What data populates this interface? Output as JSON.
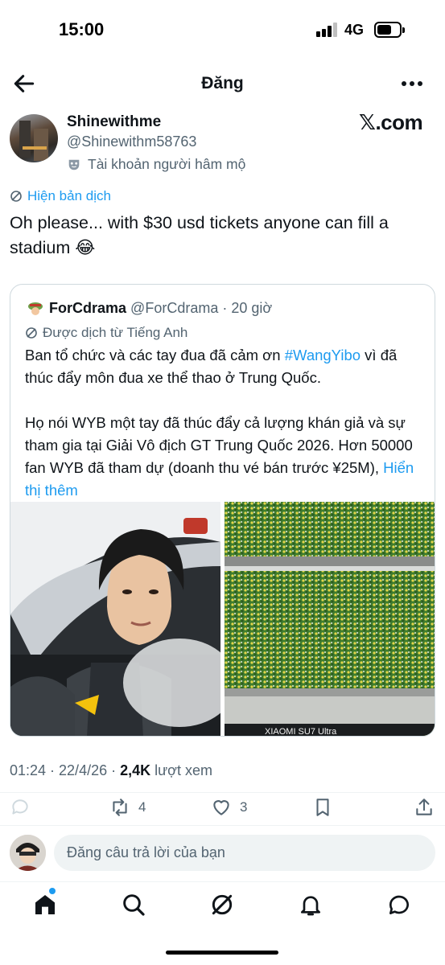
{
  "status_bar": {
    "time": "15:00",
    "network": "4G"
  },
  "header": {
    "title": "Đăng",
    "back_icon": "arrow-left-icon",
    "more_icon": "more-horizontal-icon"
  },
  "author": {
    "display_name": "Shinewithme",
    "handle": "@Shinewithm58763",
    "badge_text": "Tài khoản người hâm mộ",
    "badge_icon": "mask-icon",
    "watermark": "𝕏.com"
  },
  "post": {
    "translate_link": "Hiện bản dịch",
    "text_line1": "Oh please... with $30 usd tickets anyone can fill a",
    "text_line2": "stadium 😂",
    "timestamp": "01:24 · 22/4/26 · ",
    "views_count": "2,4K",
    "views_label": " lượt xem"
  },
  "quote": {
    "name": "ForCdrama",
    "handle": "@ForCdrama",
    "time": "· 20 giờ",
    "translated_note": "Được dịch từ Tiếng Anh",
    "para1_before": "Ban tổ chức và các tay đua đã cảm ơn ",
    "hashtag": "#WangYibo",
    "para1_after": " vì đã thúc đẩy môn đua xe thể thao ở Trung Quốc.",
    "para2": "Họ nói WYB một tay đã thúc đẩy cả lượng khán giả và sự tham gia tại Giải Vô địch GT Trung Quốc 2026. Hơn 50000 fan WYB đã tham dự (doanh thu vé bán trước ¥25M), ",
    "show_more": "Hiển thị thêm",
    "banner_text": "XIAOMI SU7 Ultra",
    "image_left": "driver-in-race-car-photo",
    "image_right": "stadium-crowd-photo"
  },
  "actions": {
    "retweets": "4",
    "likes": "3"
  },
  "reply": {
    "placeholder": "Đăng câu trả lời của bạn"
  },
  "colors": {
    "accent": "#1d9bf0",
    "text": "#0f1419",
    "muted": "#536471",
    "border": "#cfd9de"
  }
}
